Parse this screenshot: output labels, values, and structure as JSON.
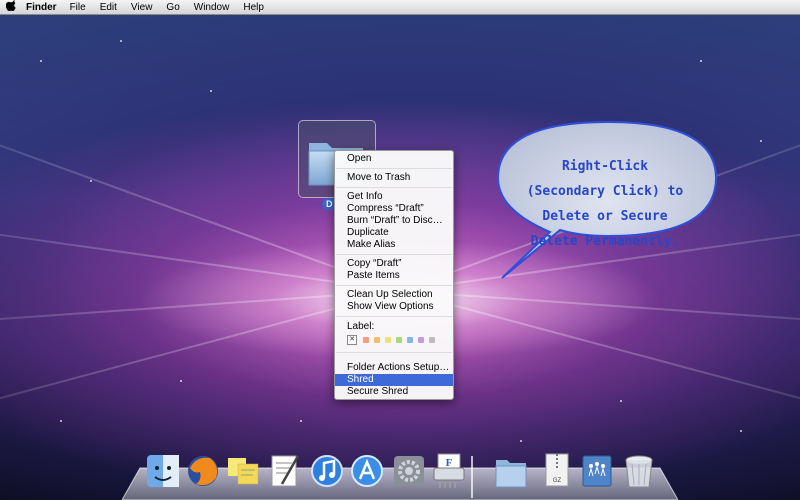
{
  "menubar": {
    "apple_icon": "",
    "app_name": "Finder",
    "menus": [
      "File",
      "Edit",
      "View",
      "Go",
      "Window",
      "Help"
    ]
  },
  "desktop_folder": {
    "label": "D",
    "icon": "folder-icon"
  },
  "context_menu": {
    "groups": [
      [
        "Open"
      ],
      [
        "Move to Trash"
      ],
      [
        "Get Info",
        "Compress “Draft”",
        "Burn “Draft” to Disc…",
        "Duplicate",
        "Make Alias"
      ],
      [
        "Copy “Draft”",
        "Paste Items"
      ],
      [
        "Clean Up Selection",
        "Show View Options"
      ],
      [
        "Folder Actions Setup…",
        "Shred",
        "Secure Shred"
      ]
    ],
    "label_header": "Label:",
    "label_none_symbol": "✕",
    "label_colors": [
      "#f0a07e",
      "#f2c06a",
      "#ede272",
      "#a7d87a",
      "#85b7ea",
      "#c89be0",
      "#bdbdbd"
    ],
    "highlighted_item": "Shred"
  },
  "callout": {
    "lines": [
      "Right-Click",
      "(Secondary Click) to",
      "Delete or Secure",
      "Delete Permanently."
    ],
    "text_color": "#2846c8",
    "border_color": "#2f4fd8"
  },
  "dock": {
    "items": [
      {
        "name": "finder-icon"
      },
      {
        "name": "firefox-icon"
      },
      {
        "name": "stickies-icon"
      },
      {
        "name": "textedit-icon"
      },
      {
        "name": "itunes-icon"
      },
      {
        "name": "app-store-icon"
      },
      {
        "name": "system-preferences-icon"
      },
      {
        "name": "shredder-app-icon"
      },
      {
        "name": "documents-folder-icon"
      },
      {
        "name": "zip-archive-icon",
        "label": "GZ"
      },
      {
        "name": "network-drive-icon"
      },
      {
        "name": "trash-icon"
      }
    ]
  }
}
